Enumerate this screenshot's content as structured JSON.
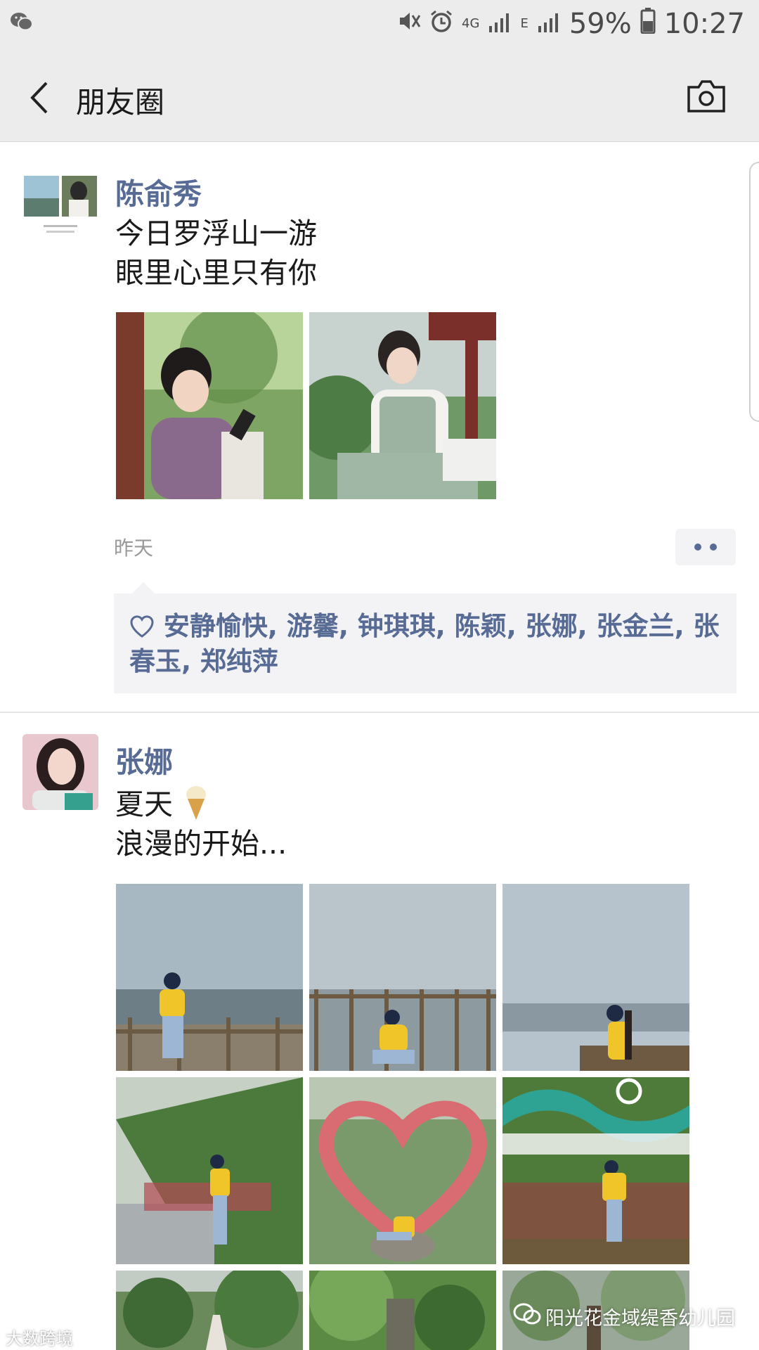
{
  "status_bar": {
    "battery": "59%",
    "time": "10:27",
    "network": "4G",
    "network2": "E"
  },
  "nav": {
    "title": "朋友圈"
  },
  "posts": [
    {
      "author": "陈俞秀",
      "lines": [
        "今日罗浮山一游",
        "眼里心里只有你"
      ],
      "time": "昨天",
      "likes": "安静愉快, 游馨, 钟琪琪, 陈颖, 张娜, 张金兰, 张春玉, 郑纯萍"
    },
    {
      "author": "张娜",
      "lines": [
        "夏天",
        "浪漫的开始..."
      ]
    }
  ],
  "watermark": {
    "right": "阳光花金域缇香幼儿园",
    "left": "大数跨境"
  },
  "colors": {
    "name": "#576b95",
    "bar_bg": "#ececec",
    "likes_bg": "#f3f3f5"
  }
}
